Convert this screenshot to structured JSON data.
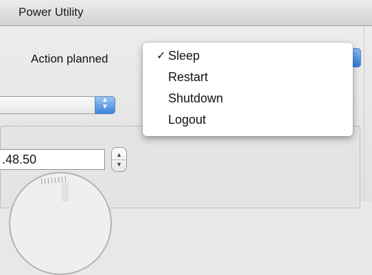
{
  "window": {
    "title": "Power Utility"
  },
  "action": {
    "label": "Action planned",
    "selected": "Sleep",
    "options": [
      {
        "label": "Sleep",
        "checked": true
      },
      {
        "label": "Restart",
        "checked": false
      },
      {
        "label": "Shutdown",
        "checked": false
      },
      {
        "label": "Logout",
        "checked": false
      }
    ],
    "checkmark": "✓"
  },
  "time": {
    "value": ".48.50"
  },
  "icons": {
    "popup_arrows": "up-down-arrows-icon",
    "stepper": "stepper-arrows-icon"
  },
  "colors": {
    "popup_accent": "#3b84dd",
    "menu_background": "#ffffff",
    "window_background": "#e8e8e8"
  }
}
